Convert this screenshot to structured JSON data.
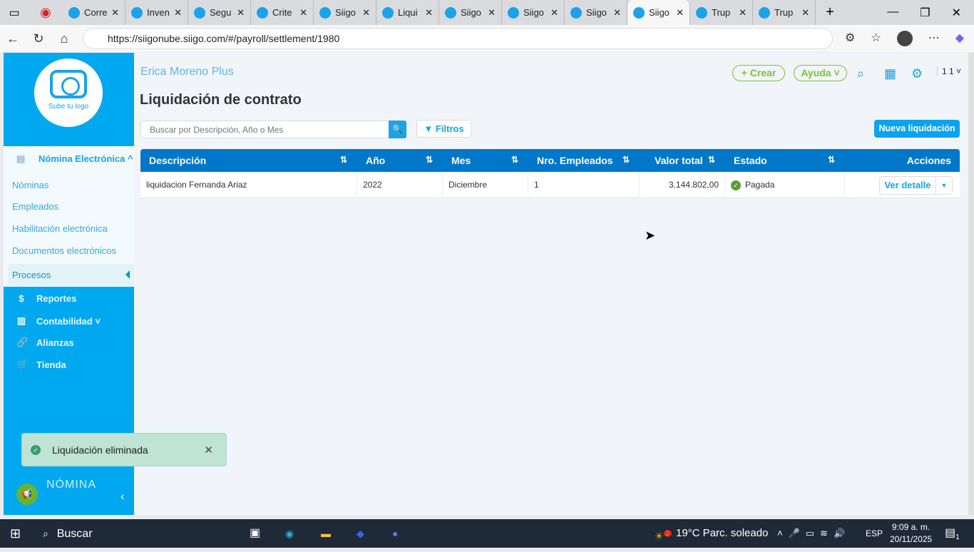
{
  "browser": {
    "tabs": [
      "Corre",
      "Inven",
      "Segu",
      "Crite",
      "Siigo",
      "Liqui",
      "Siigo",
      "Siigo",
      "Siigo",
      "Siigo",
      "Trup",
      "Trup"
    ],
    "active_tab": 9,
    "url": "https://siigonube.siigo.com/#/payroll/settlement/1980"
  },
  "sidebar": {
    "logo_text": "Sube tu logo",
    "section": "Nómina Electrónica ^",
    "sub_items": [
      "Nóminas",
      "Empleados",
      "Habilitación electrónica",
      "Documentos electrónicos"
    ],
    "active": "Procesos",
    "items": [
      {
        "icon": "$",
        "label": "Reportes"
      },
      {
        "icon": "▥",
        "label": "Contabilidad ˅"
      },
      {
        "icon": "🔗",
        "label": "Alianzas"
      },
      {
        "icon": "🛒",
        "label": "Tienda"
      }
    ],
    "brand": "NÓMINA"
  },
  "header": {
    "company": "Erica Moreno Plus",
    "crear": "+ Crear",
    "ayuda": "Ayuda ˅",
    "user": "1 1 ˅"
  },
  "page": {
    "title": "Liquidación de contrato",
    "search_placeholder": "Buscar por Descripción, Año o Mes",
    "filtros": "Filtros",
    "nueva": "Nueva liquidación"
  },
  "table": {
    "headers": [
      "Descripción",
      "Año",
      "Mes",
      "Nro. Empleados",
      "Valor total",
      "Estado",
      "Acciones"
    ],
    "rows": [
      {
        "descripcion": "liquidacion Fernanda Ariaz",
        "anio": "2022",
        "mes": "Diciembre",
        "empleados": "1",
        "valor": "3.144.802,00",
        "estado": "Pagada",
        "accion": "Ver detalle"
      }
    ]
  },
  "toast": {
    "message": "Liquidación eliminada"
  },
  "taskbar": {
    "search": "Buscar",
    "weather": "19°C  Parc. soleado",
    "weather_badge": "2",
    "lang": "ESP",
    "time": "9:09 a. m.",
    "date": "20/11/2025",
    "notifications": "1"
  }
}
